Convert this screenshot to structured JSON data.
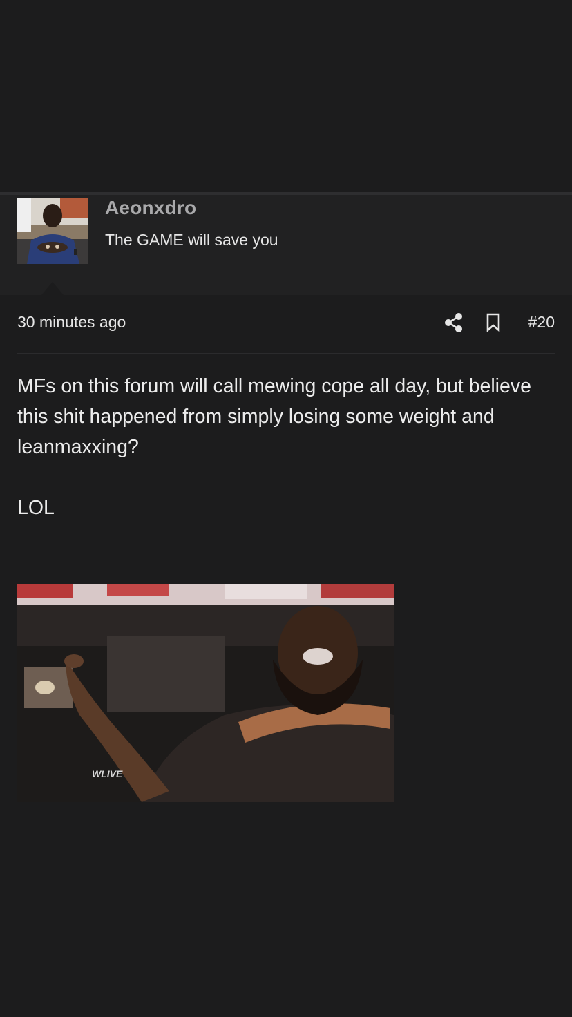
{
  "post": {
    "author": {
      "username": "Aeonxdro",
      "user_title": "The GAME will save you",
      "avatar_icon": "avatar-photo"
    },
    "meta": {
      "timestamp": "30 minutes ago",
      "share_icon": "share-icon",
      "bookmark_icon": "bookmark-icon",
      "post_number": "#20"
    },
    "body": {
      "paragraph": "MFs on this forum will call mewing cope all day, but believe this shit happened from simply losing some weight and leanmaxxing?",
      "reaction": "LOL"
    },
    "attachment": {
      "type": "gif-image",
      "watermark": "WLIVE"
    }
  },
  "colors": {
    "background": "#1c1c1d",
    "author_bar": "#212122",
    "username": "#a9a9ab",
    "text": "#e6e6e6"
  }
}
